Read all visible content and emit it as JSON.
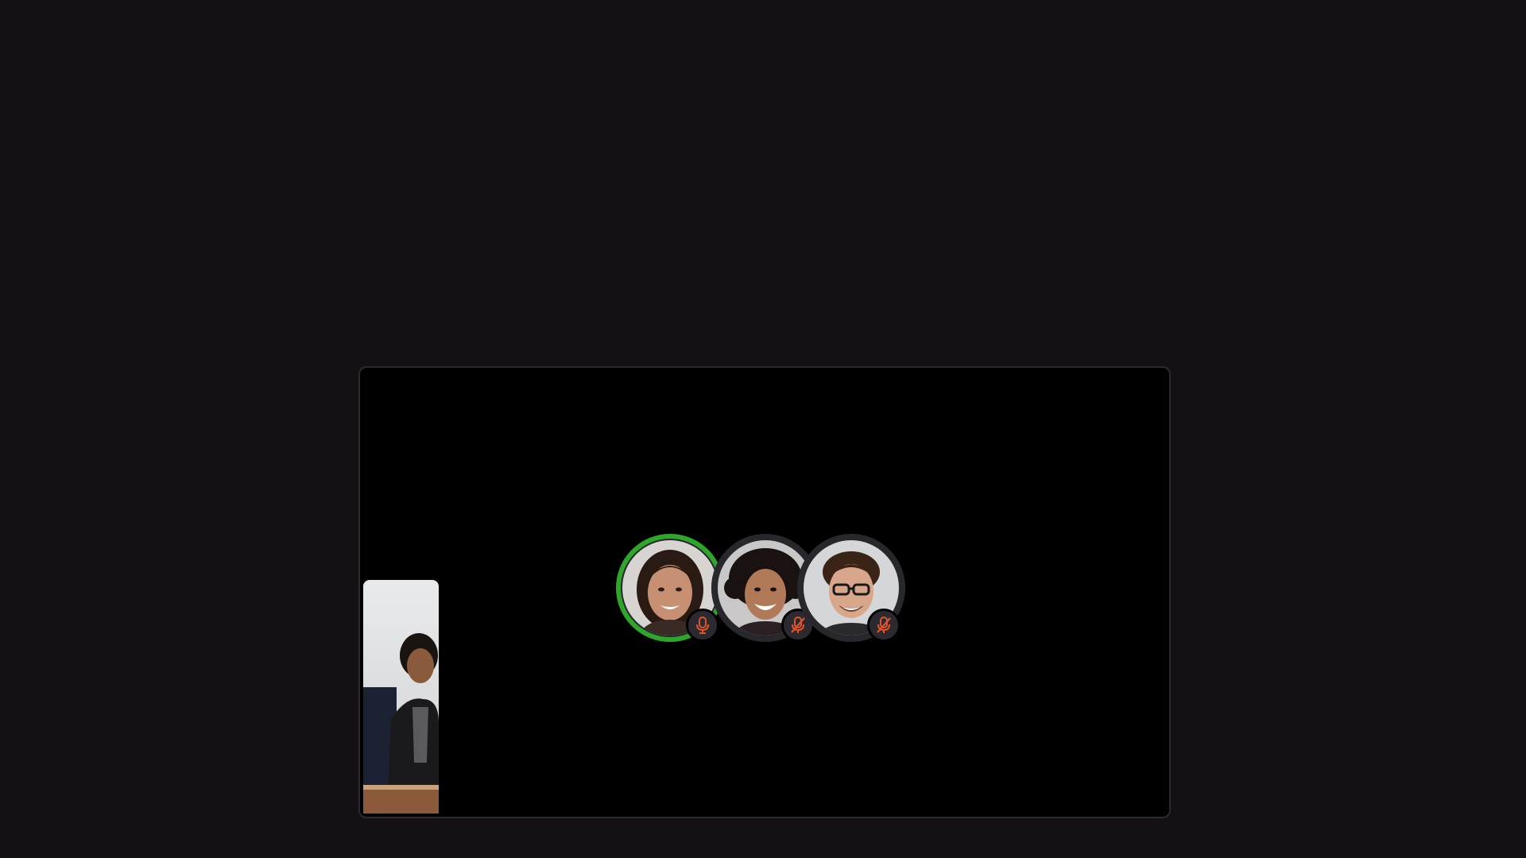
{
  "call": {
    "participants": [
      {
        "state": "speaking",
        "mic": "mic-on-icon",
        "accent": "#2ea62a"
      },
      {
        "state": "muted",
        "mic": "mic-off-icon",
        "accent": "#e0542a"
      },
      {
        "state": "muted",
        "mic": "mic-off-icon",
        "accent": "#e0542a"
      }
    ]
  },
  "colors": {
    "background": "#141014",
    "stage": "#000000",
    "speaking_ring": "#2ea62a",
    "muted_icon": "#e0542a",
    "avatar_ring": "#27272c"
  }
}
